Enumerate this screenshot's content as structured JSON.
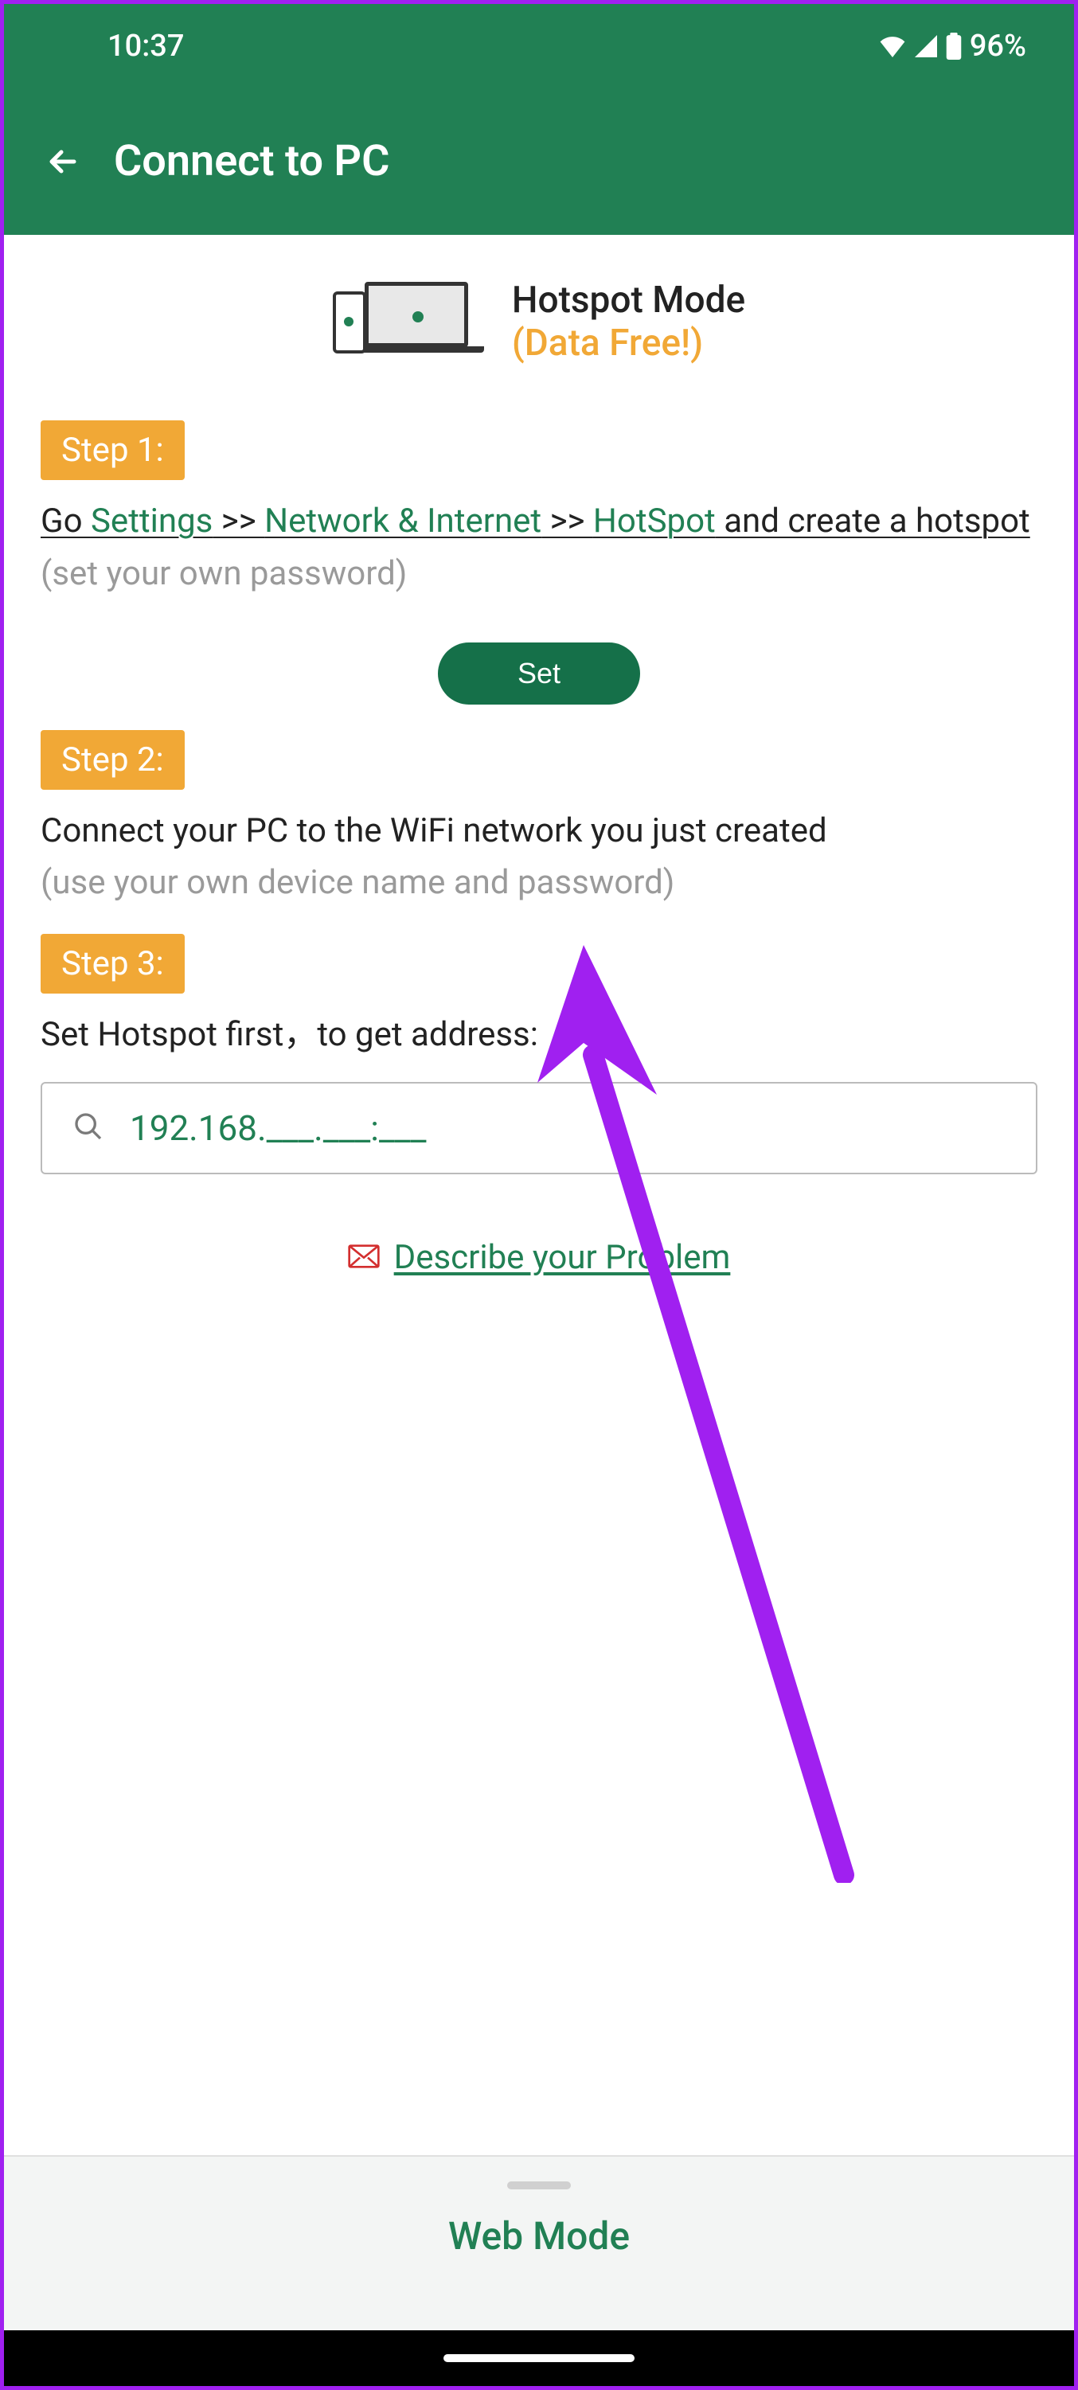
{
  "status": {
    "time": "10:37",
    "battery": "96%"
  },
  "appbar": {
    "title": "Connect to PC"
  },
  "mode": {
    "title": "Hotspot Mode",
    "subtitle": "(Data Free!)"
  },
  "step1": {
    "badge": "Step 1:",
    "text_go": "Go ",
    "link_settings": "Settings",
    "sep1": " >> ",
    "link_network": "Network & Internet",
    "sep2": " >> ",
    "link_hotspot": "HotSpot",
    "text_tail": " and create a hotspot",
    "hint": "(set your own password)",
    "set_button": "Set"
  },
  "step2": {
    "badge": "Step 2:",
    "text": "Connect your PC to the WiFi network you just created",
    "hint": "(use your own device name and password)"
  },
  "step3": {
    "badge": "Step 3:",
    "text": "Set Hotspot first，to get address:",
    "address": "192.168.___.___:___"
  },
  "problem": {
    "label": "Describe your Problem"
  },
  "bottom_sheet": {
    "label": "Web Mode"
  }
}
